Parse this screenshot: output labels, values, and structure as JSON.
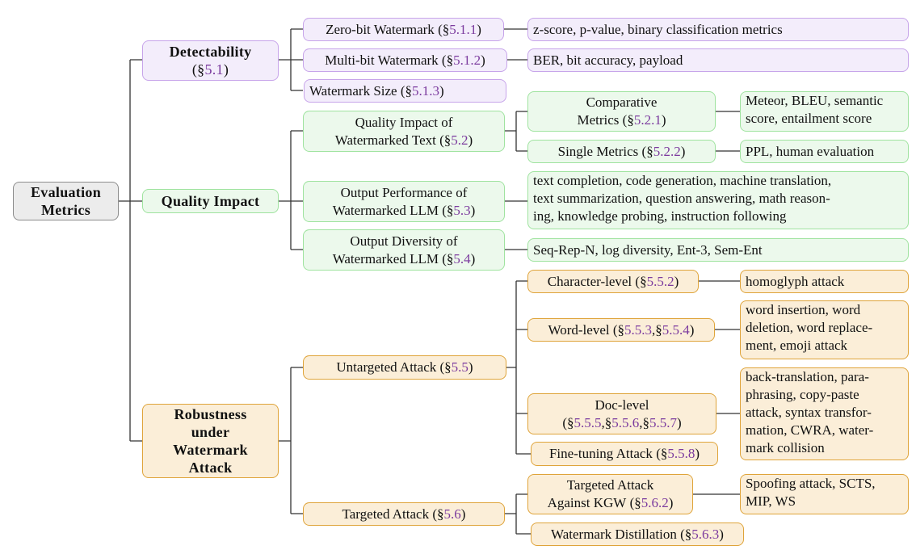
{
  "colors": {
    "root_fill": "#ececec",
    "detectability_fill": "#f3edfb",
    "detectability_border": "#c7a4ea",
    "quality_fill": "#ecf9ec",
    "quality_border": "#9fe39f",
    "robustness_fill": "#fbeed8",
    "robustness_border": "#dfa43a",
    "section_ref": "#7b3a9e"
  },
  "root": {
    "line1": "Evaluation",
    "line2": "Metrics"
  },
  "detectability": {
    "title": "Detectability",
    "sec": "5.1",
    "children": [
      {
        "label": "Zero-bit Watermark",
        "sec": "5.1.1",
        "metrics": "z-score, p-value, binary classification metrics"
      },
      {
        "label": "Multi-bit Watermark",
        "sec": "5.1.2",
        "metrics": "BER, bit accuracy, payload"
      },
      {
        "label": "Watermark Size",
        "sec": "5.1.3"
      }
    ]
  },
  "quality": {
    "title": "Quality Impact",
    "children": [
      {
        "line1": "Quality Impact of",
        "line2": "Watermarked Text",
        "sec": "5.2",
        "children": [
          {
            "line1": "Comparative",
            "line2": "Metrics",
            "sec": "5.2.1",
            "metrics_line1": "Meteor, BLEU, semantic",
            "metrics_line2": "score, entailment score"
          },
          {
            "label": "Single Metrics",
            "sec": "5.2.2",
            "metrics": "PPL, human evaluation"
          }
        ]
      },
      {
        "line1": "Output Performance of",
        "line2": "Watermarked LLM",
        "sec": "5.3",
        "metrics_lines": [
          "text completion, code generation, machine translation,",
          "text summarization, question answering, math reason-",
          "ing, knowledge probing, instruction following"
        ]
      },
      {
        "line1": "Output Diversity of",
        "line2": "Watermarked LLM",
        "sec": "5.4",
        "metrics": "Seq-Rep-N, log diversity, Ent-3, Sem-Ent"
      }
    ]
  },
  "robustness": {
    "lines": [
      "Robustness",
      "under",
      "Watermark",
      "Attack"
    ],
    "untargeted": {
      "label": "Untargeted Attack",
      "sec": "5.5",
      "children": [
        {
          "label": "Character-level",
          "secs": [
            "5.5.2"
          ],
          "metrics_lines": [
            "homoglyph attack"
          ]
        },
        {
          "label": "Word-level",
          "secs": [
            "5.5.3",
            "5.5.4"
          ],
          "metrics_lines": [
            "word insertion, word",
            "deletion, word replace-",
            "ment, emoji attack"
          ]
        },
        {
          "label": "Doc-level",
          "secs": [
            "5.5.5",
            "5.5.6",
            "5.5.7"
          ],
          "metrics_lines": [
            "back-translation, para-",
            "phrasing, copy-paste",
            "attack, syntax transfor-",
            "mation, CWRA, water-",
            "mark collision"
          ]
        },
        {
          "label": "Fine-tuning Attack",
          "secs": [
            "5.5.8"
          ]
        }
      ]
    },
    "targeted": {
      "label": "Targeted Attack",
      "sec": "5.6",
      "children": [
        {
          "line1": "Targeted Attack",
          "line2": "Against KGW",
          "sec": "5.6.2",
          "metrics_lines": [
            "Spoofing attack, SCTS,",
            "MIP, WS"
          ]
        },
        {
          "label": "Watermark Distillation",
          "sec": "5.6.3"
        }
      ]
    }
  },
  "symbols": {
    "section": "§",
    "open": "(",
    "close": ")",
    "comma": ","
  }
}
